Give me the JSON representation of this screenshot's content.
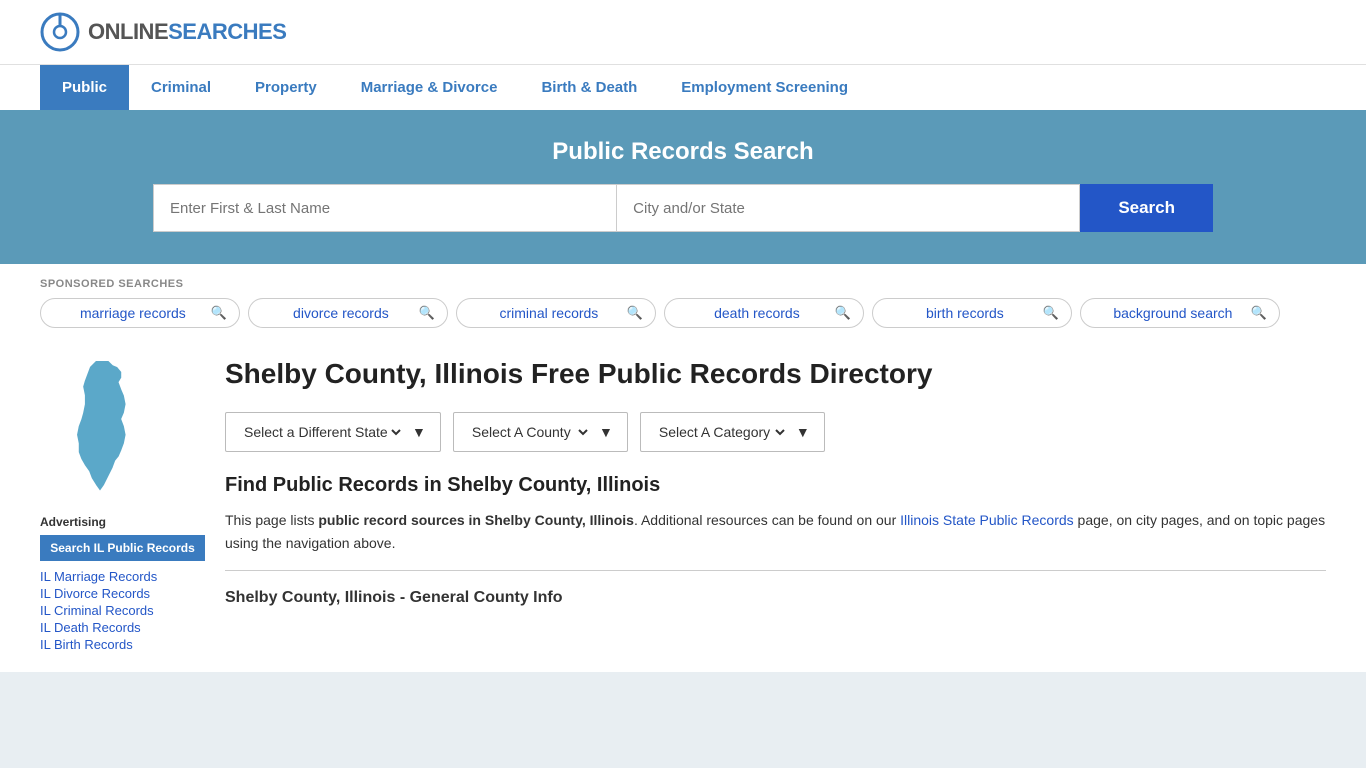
{
  "logo": {
    "online": "ONLINE",
    "searches": "SEARCHES"
  },
  "nav": {
    "items": [
      {
        "label": "Public",
        "active": true
      },
      {
        "label": "Criminal",
        "active": false
      },
      {
        "label": "Property",
        "active": false
      },
      {
        "label": "Marriage & Divorce",
        "active": false
      },
      {
        "label": "Birth & Death",
        "active": false
      },
      {
        "label": "Employment Screening",
        "active": false
      }
    ]
  },
  "hero": {
    "title": "Public Records Search",
    "name_placeholder": "Enter First & Last Name",
    "location_placeholder": "City and/or State",
    "search_btn": "Search"
  },
  "sponsored": {
    "label": "SPONSORED SEARCHES",
    "pills": [
      {
        "text": "marriage records"
      },
      {
        "text": "divorce records"
      },
      {
        "text": "criminal records"
      },
      {
        "text": "death records"
      },
      {
        "text": "birth records"
      },
      {
        "text": "background search"
      }
    ]
  },
  "page_title": "Shelby County, Illinois Free Public Records Directory",
  "dropdowns": {
    "state": "Select a Different State",
    "county": "Select A County",
    "category": "Select A Category"
  },
  "find_section": {
    "title": "Find Public Records in Shelby County, Illinois",
    "text_before": "This page lists ",
    "text_bold": "public record sources in Shelby County, Illinois",
    "text_middle": ". Additional resources can be found on our ",
    "link_text": "Illinois State Public Records",
    "text_after": " page, on city pages, and on topic pages using the navigation above."
  },
  "section_subtitle": "Shelby County, Illinois - General County Info",
  "sidebar": {
    "advertising": "Advertising",
    "ad_btn": "Search IL Public Records",
    "links": [
      "IL Marriage Records",
      "IL Divorce Records",
      "IL Criminal Records",
      "IL Death Records",
      "IL Birth Records"
    ]
  }
}
